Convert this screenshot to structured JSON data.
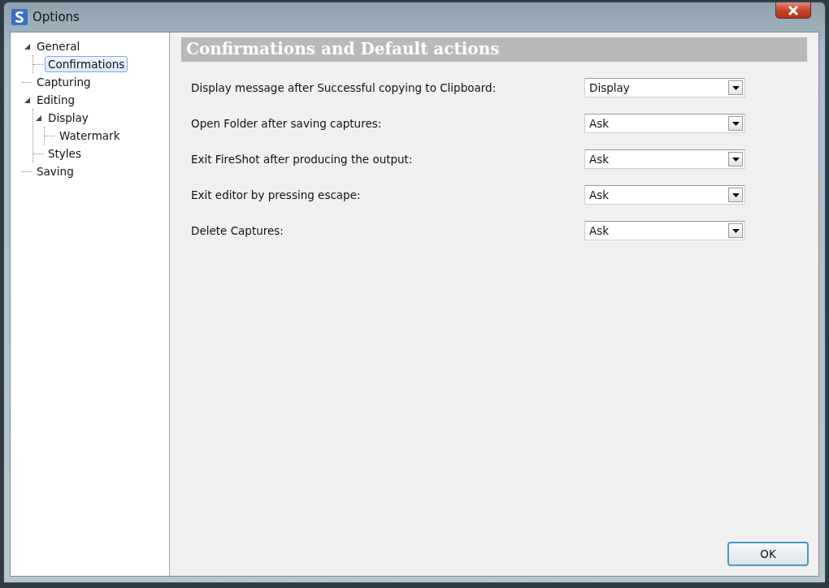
{
  "window": {
    "title": "Options"
  },
  "tree": [
    {
      "label": "General",
      "expanded": true,
      "selected": false,
      "children": [
        {
          "label": "Confirmations",
          "selected": true
        }
      ]
    },
    {
      "label": "Capturing",
      "selected": false
    },
    {
      "label": "Editing",
      "expanded": true,
      "selected": false,
      "children": [
        {
          "label": "Display",
          "expanded": true,
          "selected": false,
          "children": [
            {
              "label": "Watermark",
              "selected": false
            }
          ]
        },
        {
          "label": "Styles",
          "selected": false
        }
      ]
    },
    {
      "label": "Saving",
      "selected": false
    }
  ],
  "panel": {
    "heading": "Confirmations and Default actions",
    "settings": [
      {
        "label": "Display message after Successful copying to Clipboard:",
        "value": "Display"
      },
      {
        "label": "Open Folder after saving captures:",
        "value": "Ask"
      },
      {
        "label": "Exit FireShot after producing the output:",
        "value": "Ask"
      },
      {
        "label": "Exit editor by pressing escape:",
        "value": "Ask"
      },
      {
        "label": "Delete Captures:",
        "value": "Ask"
      }
    ]
  },
  "buttons": [
    "OK"
  ]
}
